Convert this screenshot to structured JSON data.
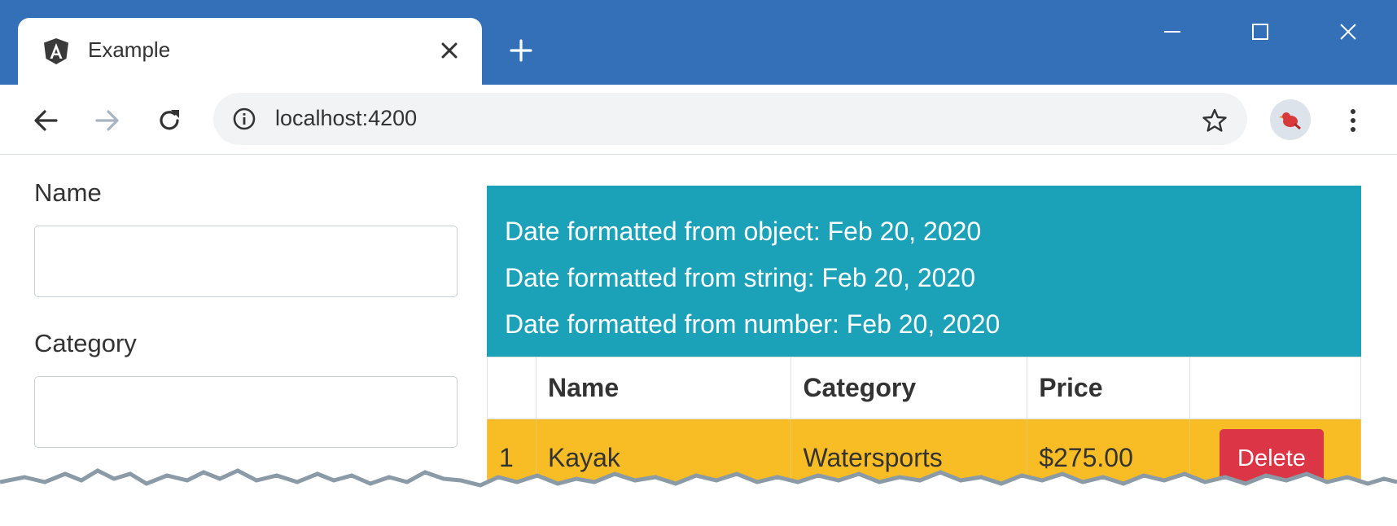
{
  "browser": {
    "tab": {
      "title": "Example",
      "favicon": "angular-icon"
    },
    "new_tab_icon": "plus-icon",
    "window_controls": [
      "minimize-icon",
      "maximize-icon",
      "close-icon"
    ],
    "nav": [
      "back-icon",
      "forward-icon",
      "reload-icon"
    ],
    "omnibox": {
      "url": "localhost:4200",
      "info_icon": "info-icon",
      "bookmark_icon": "star-icon"
    },
    "profile_icon": "profile-bird-icon",
    "menu_icon": "kebab-menu-icon",
    "colors": {
      "titlebar": "#3370b7",
      "omnibox": "#f1f3f4"
    }
  },
  "form": {
    "name_label": "Name",
    "name_value": "",
    "category_label": "Category",
    "category_value": ""
  },
  "dates": {
    "object_line": "Date formatted from object: Feb 20, 2020",
    "string_line": "Date formatted from string: Feb 20, 2020",
    "number_line": "Date formatted from number: Feb 20, 2020",
    "color": "#1ba2b8"
  },
  "table": {
    "headers": [
      "",
      "Name",
      "Category",
      "Price",
      ""
    ],
    "rows": [
      {
        "index": "1",
        "name": "Kayak",
        "category": "Watersports",
        "price": "$275.00",
        "action": "Delete"
      }
    ],
    "row_color": "#f8bd24",
    "delete_color": "#dc3545"
  }
}
